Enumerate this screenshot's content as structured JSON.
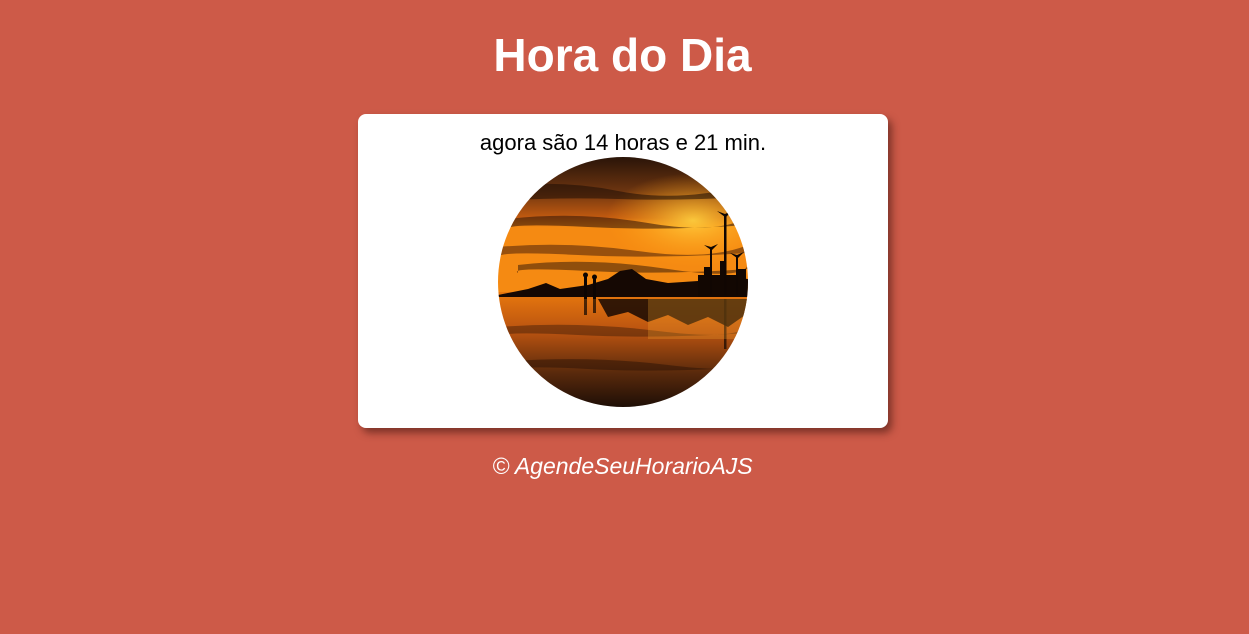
{
  "header": {
    "title": "Hora do Dia"
  },
  "card": {
    "time_message": "agora são 14 horas e 21 min.",
    "image": {
      "subject": "sunset-beach-photo",
      "shape": "circle"
    }
  },
  "footer": {
    "copyright": "© AgendeSeuHorarioAJS"
  },
  "colors": {
    "background": "#cd5a48",
    "card": "#ffffff",
    "title_text": "#ffffff",
    "body_text": "#000000"
  }
}
